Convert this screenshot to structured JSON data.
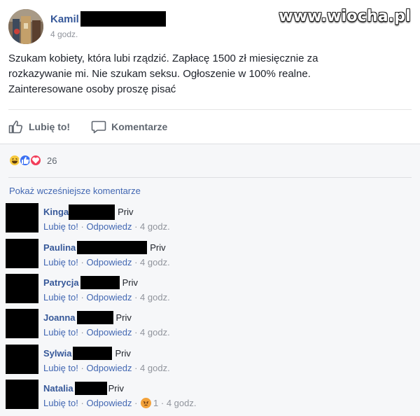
{
  "post": {
    "author": "Kamil",
    "time": "4 godz.",
    "text": "Szukam kobiety, która lubi rządzić. Zapłacę 1500 zł miesięcznie za\nrozkazywanie mi. Nie szukam seksu. Ogłoszenie w 100% realne.\nZainteresowane osoby proszę pisać",
    "watermark": "www.wiocha.pl",
    "actions": {
      "like": "Lubię to!",
      "comment": "Komentarze"
    }
  },
  "reactions": {
    "icons": [
      "haha-reaction-icon",
      "like-reaction-icon",
      "love-reaction-icon"
    ],
    "count": "26"
  },
  "comments_section": {
    "view_more": "Pokaż wcześniejsze komentarze",
    "items": [
      {
        "name": "Kinga",
        "text": "Priv",
        "like": "Lubię to!",
        "reply": "Odpowiedz",
        "sep1": " · ",
        "sep2": " · ",
        "time": "4 godz."
      },
      {
        "name": "Paulina",
        "text": "Priv",
        "like": "Lubię to!",
        "reply": "Odpowiedz",
        "sep1": " · ",
        "sep2": " · ",
        "time": "4 godz."
      },
      {
        "name": "Patrycja",
        "text": "Priv",
        "like": "Lubię to!",
        "reply": "Odpowiedz",
        "sep1": " · ",
        "sep2": " · ",
        "time": "4 godz."
      },
      {
        "name": "Joanna",
        "text": "Priv",
        "like": "Lubię to!",
        "reply": "Odpowiedz",
        "sep1": " · ",
        "sep2": " · ",
        "time": "4 godz."
      },
      {
        "name": "Sylwia",
        "text": "Priv",
        "like": "Lubię to!",
        "reply": "Odpowiedz",
        "sep1": " · ",
        "sep2": " · ",
        "time": "4 godz."
      },
      {
        "name": "Natalia",
        "text": "Priv",
        "like": "Lubię to!",
        "reply": "Odpowiedz",
        "sep1": " · ",
        "sep2": " · ",
        "reaction_count": "1",
        "sep3": " · ",
        "time": "4 godz."
      }
    ]
  },
  "colors": {
    "link": "#365899",
    "muted": "#90949c",
    "background": "#f6f7f9"
  }
}
